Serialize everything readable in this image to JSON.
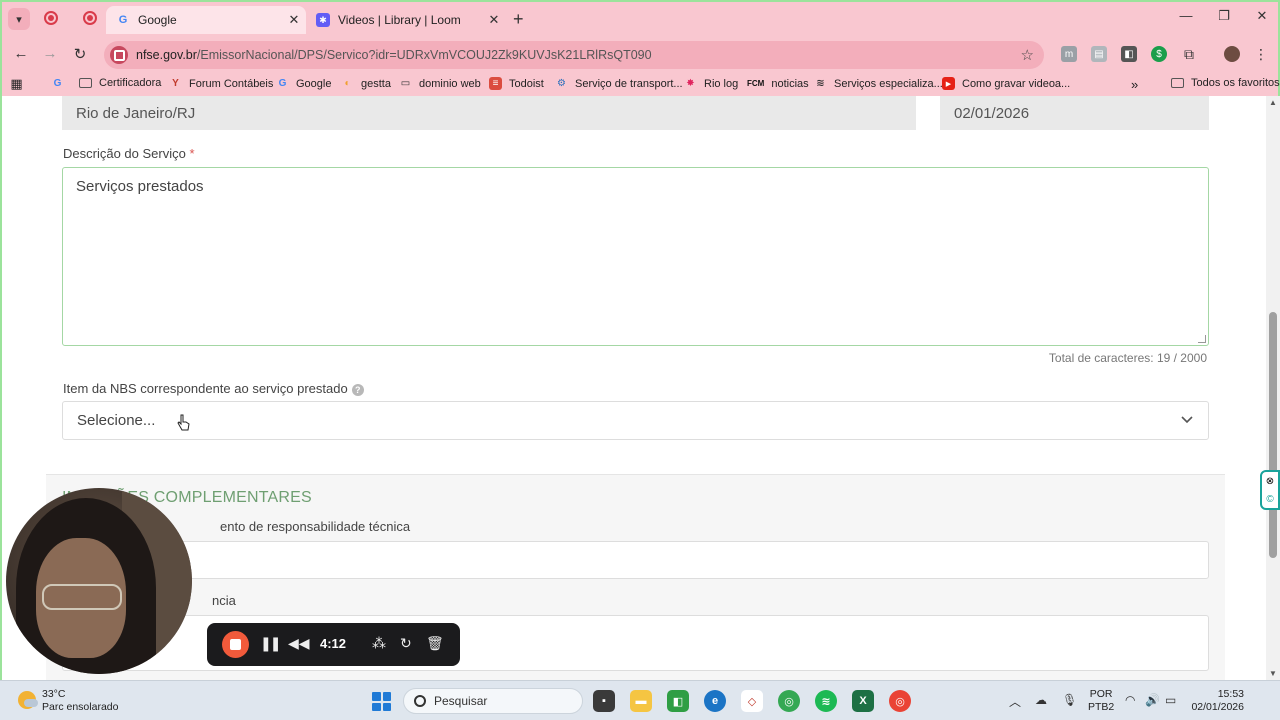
{
  "browser": {
    "tabs": [
      {
        "title": "Google",
        "active": true
      },
      {
        "title": "Videos | Library | Loom",
        "active": false
      }
    ],
    "url_domain": "nfse.gov.br",
    "url_path": "/EmissorNacional/DPS/Servico?idr=UDRxVmVCOUJ2Zk9KUVJsK21LRlRsQT090",
    "bookmarks": [
      {
        "label": "Certificadora",
        "icon": "folder-icon"
      },
      {
        "label": "Forum Contábeis",
        "icon": "forum-icon"
      },
      {
        "label": "Google",
        "icon": "google-icon"
      },
      {
        "label": "gestta",
        "icon": "gestta-icon"
      },
      {
        "label": "dominio web",
        "icon": "monitor-icon"
      },
      {
        "label": "Todoist",
        "icon": "todoist-icon"
      },
      {
        "label": "Serviço de transport...",
        "icon": "transport-icon"
      },
      {
        "label": "Rio log",
        "icon": "riolog-icon"
      },
      {
        "label": "noticias",
        "icon": "fcm-icon"
      },
      {
        "label": "Serviços especializa...",
        "icon": "services-icon"
      },
      {
        "label": "Como gravar videoa...",
        "icon": "youtube-icon"
      }
    ],
    "more_bookmarks": "»",
    "all_favorites": "Todos os favoritos",
    "fcm_text": "FCM"
  },
  "form": {
    "municipio_value": "Rio de Janeiro/RJ",
    "date_value": "02/01/2026",
    "descricao_label": "Descrição do Serviço",
    "required_mark": "*",
    "descricao_value": "Serviços prestados",
    "char_counter": "Total de caracteres: 19 / 2000",
    "nbs_label": "Item da NBS correspondente ao serviço prestado",
    "nbs_help": "?",
    "nbs_select_value": "Selecione...",
    "section_title": "INFORMAÇÕES COMPLEMENTARES",
    "section_title_visible": "INF    AÇÕES COMPLEMENTARES",
    "resp_tecnica_label": "Documento de responsabilidade técnica",
    "resp_tecnica_label_visible": "ento de responsabilidade técnica",
    "referencia_label_visible": "ncia"
  },
  "loom": {
    "timer": "4:12"
  },
  "taskbar": {
    "temperature": "33°C",
    "weather_desc": "Parc ensolarado",
    "search_placeholder": "Pesquisar",
    "lang_line1": "POR",
    "lang_line2": "PTB2",
    "time": "15:53",
    "date": "02/01/2026"
  },
  "colors": {
    "chrome_bg": "#f9c7d0",
    "section_title": "#6f9f72",
    "textarea_border": "#a4d7a4",
    "loom_stop": "#f15a3b"
  }
}
